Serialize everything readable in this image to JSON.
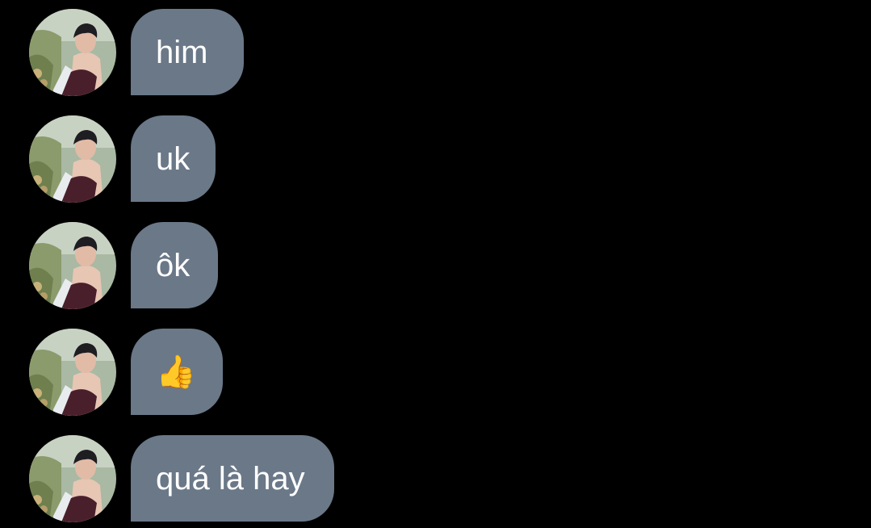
{
  "conversation": {
    "messages": [
      {
        "text": "him",
        "avatar_icon": "user-avatar-photo"
      },
      {
        "text": "uk",
        "avatar_icon": "user-avatar-photo"
      },
      {
        "text": "ôk",
        "avatar_icon": "user-avatar-photo"
      },
      {
        "text": "👍",
        "avatar_icon": "user-avatar-photo"
      },
      {
        "text": "quá là hay",
        "avatar_icon": "user-avatar-photo"
      }
    ]
  },
  "colors": {
    "background": "#000000",
    "bubble": "#6a7888",
    "bubble_text": "#ffffff"
  }
}
